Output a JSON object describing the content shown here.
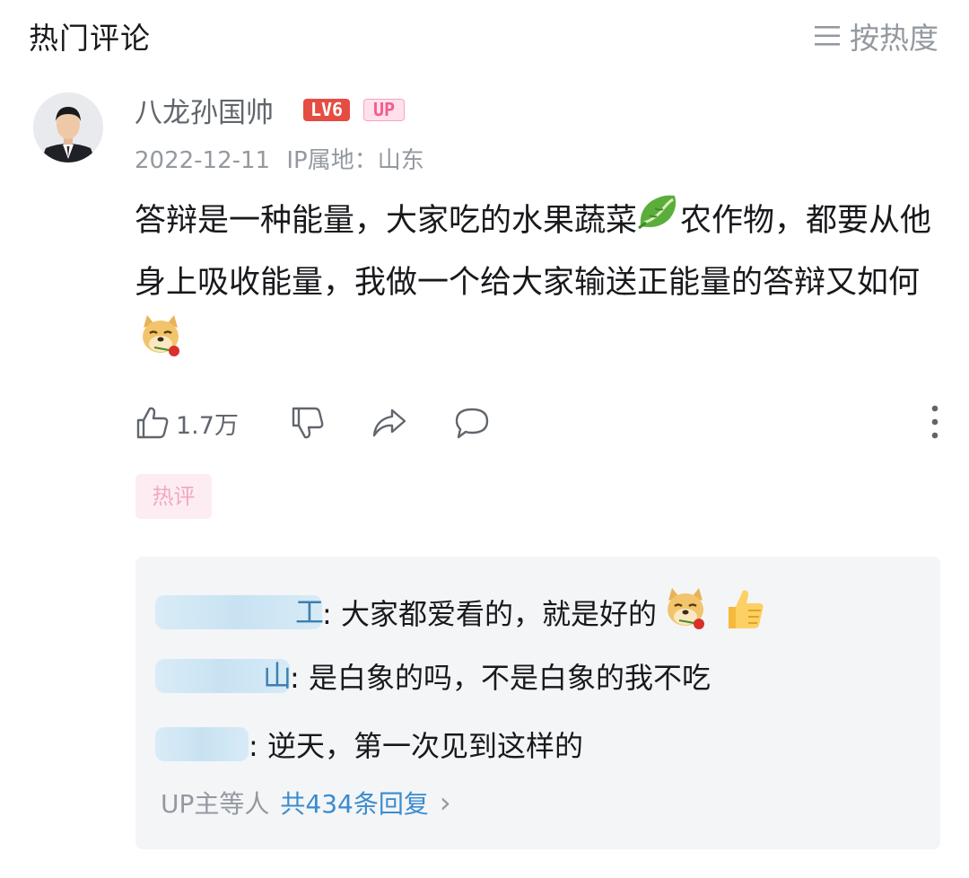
{
  "header": {
    "title": "热门评论",
    "sort_label": "按热度"
  },
  "comment": {
    "username": "八龙孙国帅",
    "level_badge": "LV6",
    "up_badge": "UP",
    "date": "2022-12-11",
    "ip_location": "IP属地：山东",
    "content_part1": "答辩是一种能量，大家吃的水果蔬菜",
    "content_part2": "农作物，都要从他身上吸收能量，我做一个给大家输送正能量的答辩又如何",
    "like_count": "1.7万",
    "hot_tag": "热评"
  },
  "replies": {
    "items": [
      {
        "name_tail": "工",
        "text": ": 大家都爱看的，就是好的"
      },
      {
        "name_tail": "山",
        "text": ": 是白象的吗，不是白象的我不吃"
      },
      {
        "name_tail": "",
        "text": ": 逆天，第一次见到这样的"
      }
    ],
    "more_who": "UP主等人",
    "more_count": "共434条回复",
    "more_chevron": "›"
  },
  "colors": {
    "accent_blue": "#3a8ccf",
    "level_red": "#e54d42",
    "up_pink": "#f25d8e",
    "muted_gray": "#9499a0"
  },
  "icons": [
    "menu-lines-icon",
    "thumb-up-icon",
    "thumb-down-icon",
    "share-icon",
    "comment-icon",
    "more-vertical-icon",
    "lettuce-emoji-icon",
    "doge-rose-emoji-icon",
    "thumbs-up-emoji-icon"
  ]
}
